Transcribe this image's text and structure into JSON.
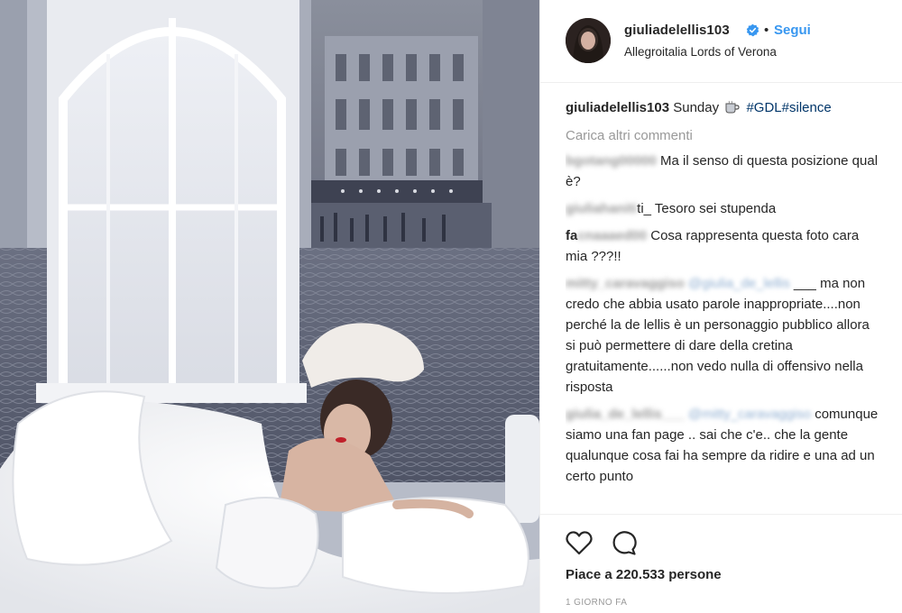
{
  "post": {
    "username": "giuliadelellis103",
    "follow_label": "Segui",
    "separator": "•",
    "location": "Allegroitalia Lords of Verona"
  },
  "caption": {
    "username": "giuliadelellis103",
    "text": "Sunday",
    "icon": "coffee-icon",
    "hashtags": "#GDL#silence"
  },
  "load_more_label": "Carica altri commenti",
  "comments": [
    {
      "user": "bgotang00000",
      "text": "Ma il senso di questa posizione qual è?"
    },
    {
      "user": "giuliahaniti",
      "text": "ti_ Tesoro sei stupenda"
    },
    {
      "user": "fa",
      "user_blur": "cnaaaed00",
      "text": "Cosa rappresenta questa foto cara mia ???!!"
    },
    {
      "user": "mitty_caravaggiso",
      "mention": "@giulia_de_lellis",
      "text": "___ ma non credo che abbia usato parole inappropriate....non perché la de lellis è un personaggio pubblico allora si può permettere di dare della cretina gratuitamente......non vedo nulla di offensivo nella risposta"
    },
    {
      "user": "giulia_de_lellis___",
      "mention": "@mitty_caravaggiso",
      "text": "comunque siamo una fan page .. sai che c'e.. che la gente qualunque cosa fai ha sempre da ridire e una ad un certo punto"
    }
  ],
  "actions": {
    "like_icon": "heart-icon",
    "comment_icon": "comment-bubble-icon",
    "likes_text": "Piace a 220.533 persone",
    "time_ago": "1 GIORNO FA"
  },
  "colors": {
    "link": "#3897f0",
    "hashtag": "#003569",
    "muted": "#999999",
    "text": "#262626"
  }
}
